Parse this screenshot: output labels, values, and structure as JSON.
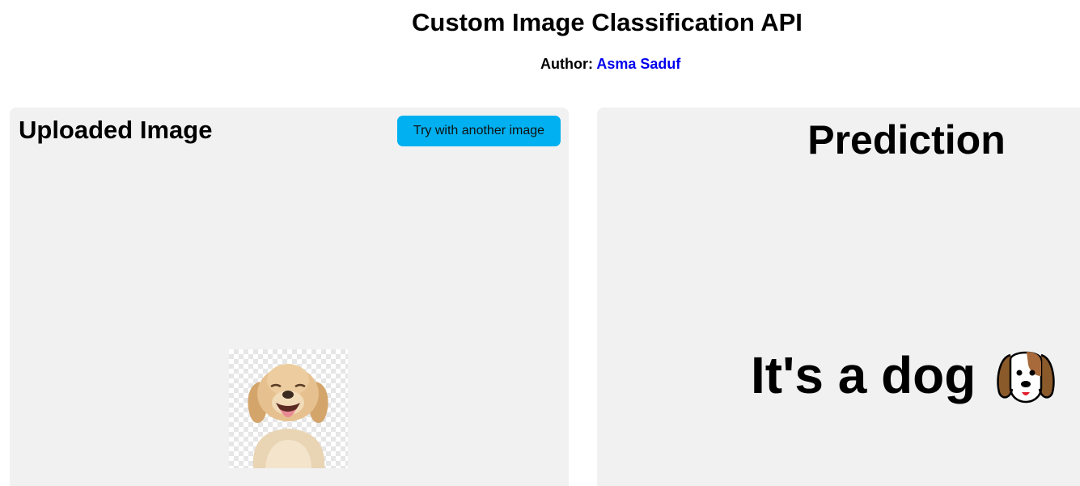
{
  "header": {
    "title": "Custom Image Classification API",
    "author_label": "Author:",
    "author_name": "Asma Saduf"
  },
  "left_panel": {
    "heading": "Uploaded Image",
    "button_label": "Try with another image",
    "image_alt": "puppy"
  },
  "right_panel": {
    "heading": "Prediction",
    "result_text": "It's a dog",
    "result_icon": "dog-face-icon"
  },
  "colors": {
    "panel_bg": "#f1f1f1",
    "button_bg": "#00b0f0",
    "link": "#0000ee"
  }
}
